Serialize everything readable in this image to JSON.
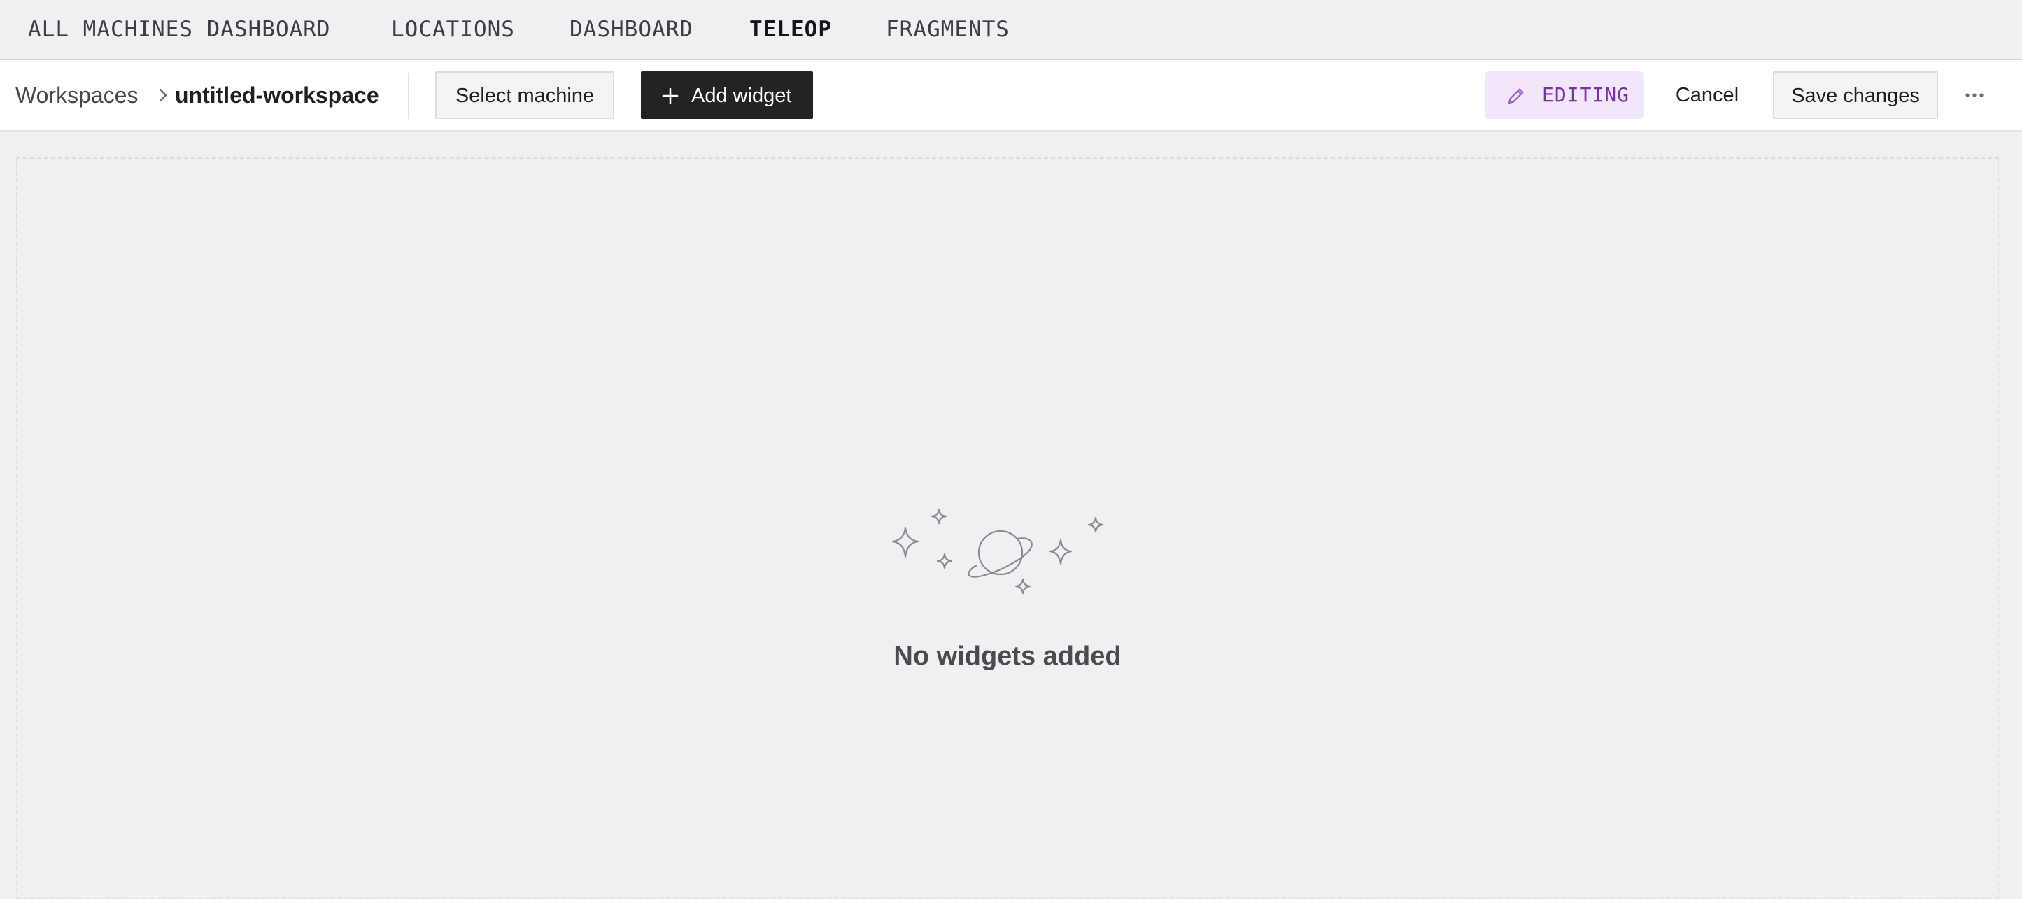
{
  "nav": {
    "tabs": [
      {
        "label": "ALL MACHINES DASHBOARD",
        "active": false
      },
      {
        "label": "LOCATIONS",
        "active": false
      },
      {
        "label": "DASHBOARD",
        "active": false
      },
      {
        "label": "TELEOP",
        "active": true
      },
      {
        "label": "FRAGMENTS",
        "active": false
      }
    ]
  },
  "toolbar": {
    "breadcrumb": {
      "root": "Workspaces",
      "current": "untitled-workspace",
      "separator_icon": "chevron-right-icon"
    },
    "select_machine_label": "Select machine",
    "add_widget_label": "Add widget",
    "add_widget_icon": "plus-icon",
    "editing_label": "EDITING",
    "editing_icon": "pencil-icon",
    "cancel_label": "Cancel",
    "save_label": "Save changes",
    "more_icon": "more-horizontal-icon"
  },
  "canvas": {
    "empty_icon": "planet-stars-icon",
    "empty_message": "No widgets added"
  },
  "colors": {
    "page_background": "#f0f0f2",
    "toolbar_background": "#ffffff",
    "primary_button": "#232323",
    "editing_badge_background": "#f2e6fb",
    "editing_badge_text": "#7a2fb0",
    "illustration_stroke": "#8a8a90"
  }
}
